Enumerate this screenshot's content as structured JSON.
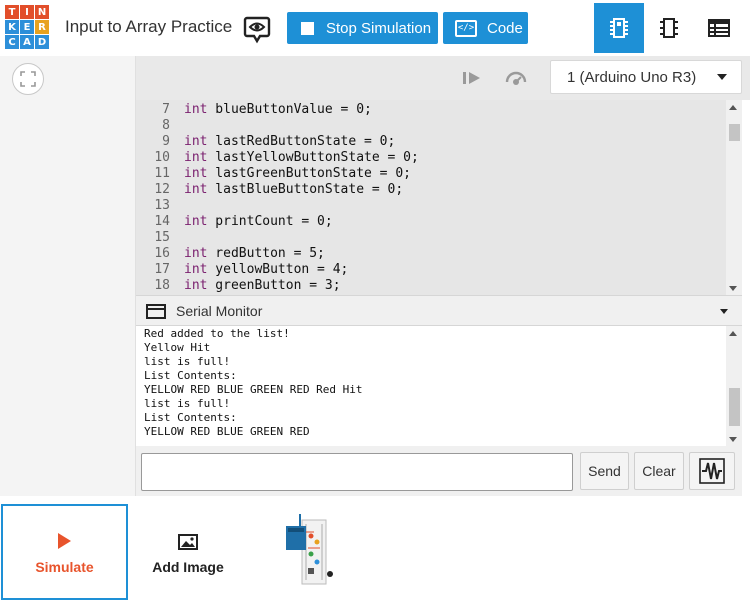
{
  "logo": {
    "letters": [
      "T",
      "I",
      "N",
      "K",
      "E",
      "R",
      "C",
      "A",
      "D"
    ],
    "colors": [
      "#e24e2a",
      "#e24e2a",
      "#e24e2a",
      "#2d8fd9",
      "#2d8fd9",
      "#e8a21f",
      "#2d8fd9",
      "#2d8fd9",
      "#2d8fd9"
    ]
  },
  "header": {
    "title": "Input to Array Practice",
    "stop_simulation_label": "Stop Simulation",
    "code_label": "Code",
    "code_icon_glyph": "</>"
  },
  "toolbar": {
    "board_select_value": "1 (Arduino Uno R3)"
  },
  "editor": {
    "lines": [
      {
        "num": "7",
        "kw": "int",
        "rest": " blueButtonValue = 0;"
      },
      {
        "num": "8",
        "kw": "",
        "rest": ""
      },
      {
        "num": "9",
        "kw": "int",
        "rest": " lastRedButtonState = 0;"
      },
      {
        "num": "10",
        "kw": "int",
        "rest": " lastYellowButtonState = 0;"
      },
      {
        "num": "11",
        "kw": "int",
        "rest": " lastGreenButtonState = 0;"
      },
      {
        "num": "12",
        "kw": "int",
        "rest": " lastBlueButtonState = 0;"
      },
      {
        "num": "13",
        "kw": "",
        "rest": ""
      },
      {
        "num": "14",
        "kw": "int",
        "rest": " printCount = 0;"
      },
      {
        "num": "15",
        "kw": "",
        "rest": ""
      },
      {
        "num": "16",
        "kw": "int",
        "rest": " redButton = 5;"
      },
      {
        "num": "17",
        "kw": "int",
        "rest": " yellowButton = 4;"
      },
      {
        "num": "18",
        "kw": "int",
        "rest": " greenButton = 3;"
      }
    ]
  },
  "serial_monitor": {
    "title": "Serial Monitor",
    "output": [
      "Red added to the list!",
      "Yellow Hit",
      "list is full!",
      "List Contents:",
      "YELLOW RED BLUE GREEN RED Red Hit",
      "list is full!",
      "List Contents:",
      "YELLOW RED BLUE GREEN RED"
    ],
    "input_value": "",
    "send_label": "Send",
    "clear_label": "Clear"
  },
  "bottom": {
    "simulate_label": "Simulate",
    "add_image_label": "Add Image"
  },
  "colors": {
    "accent_blue": "#1e90d6",
    "simulate_orange": "#e8542c",
    "keyword_purple": "#7a1f6e"
  }
}
